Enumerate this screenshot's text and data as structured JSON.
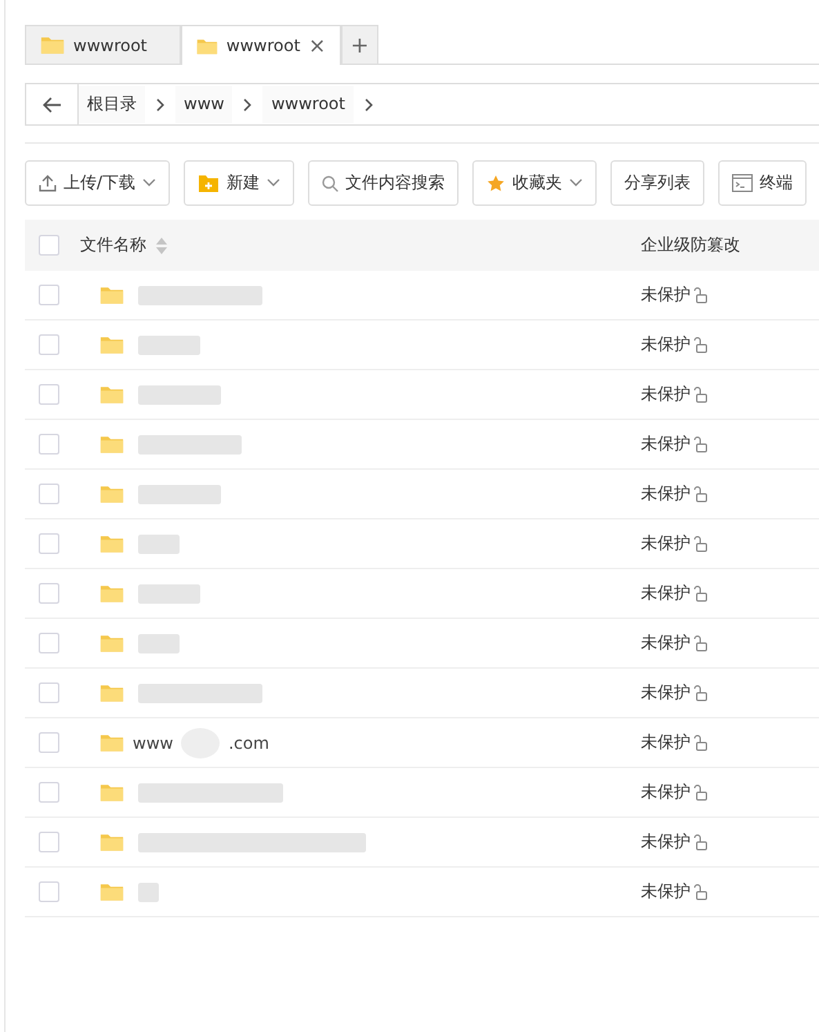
{
  "tabs": [
    {
      "label": "wwwroot",
      "selected": false
    },
    {
      "label": "wwwroot",
      "selected": true,
      "close": "×"
    }
  ],
  "new_tab": "+",
  "breadcrumb": [
    "根目录",
    "www",
    "wwwroot"
  ],
  "toolbar": [
    {
      "kind": "upload",
      "label": "上传/下载",
      "dropdown": true
    },
    {
      "kind": "new",
      "label": "新建",
      "dropdown": true
    },
    {
      "kind": "search",
      "label": "文件内容搜索",
      "dropdown": false
    },
    {
      "kind": "favorite",
      "label": "收藏夹",
      "dropdown": true
    },
    {
      "kind": "plain",
      "label": "分享列表",
      "dropdown": false
    },
    {
      "kind": "terminal",
      "label": "终端",
      "dropdown": false
    }
  ],
  "table": {
    "columns": [
      "文件名称",
      "企业级防篡改"
    ],
    "all_checked": false,
    "rows": [
      {
        "kind": "redacted",
        "checked": false,
        "protection": "未保护"
      },
      {
        "kind": "redacted",
        "checked": false,
        "protection": "未保护"
      },
      {
        "kind": "redacted",
        "checked": false,
        "protection": "未保护"
      },
      {
        "kind": "redacted",
        "checked": false,
        "protection": "未保护"
      },
      {
        "kind": "redacted",
        "checked": false,
        "protection": "未保护"
      },
      {
        "kind": "redacted",
        "checked": false,
        "protection": "未保护"
      },
      {
        "kind": "redacted",
        "checked": false,
        "protection": "未保护"
      },
      {
        "kind": "redacted",
        "checked": false,
        "protection": "未保护"
      },
      {
        "kind": "redacted",
        "checked": false,
        "protection": "未保护"
      },
      {
        "kind": "partial",
        "checked": false,
        "name_start": "www",
        "name_end": ".com",
        "protection": "未保护"
      },
      {
        "kind": "redacted",
        "checked": false,
        "protection": "未保护"
      },
      {
        "kind": "redacted",
        "checked": false,
        "protection": "未保护"
      },
      {
        "kind": "redacted",
        "checked": false,
        "protection": "未保护"
      }
    ]
  }
}
